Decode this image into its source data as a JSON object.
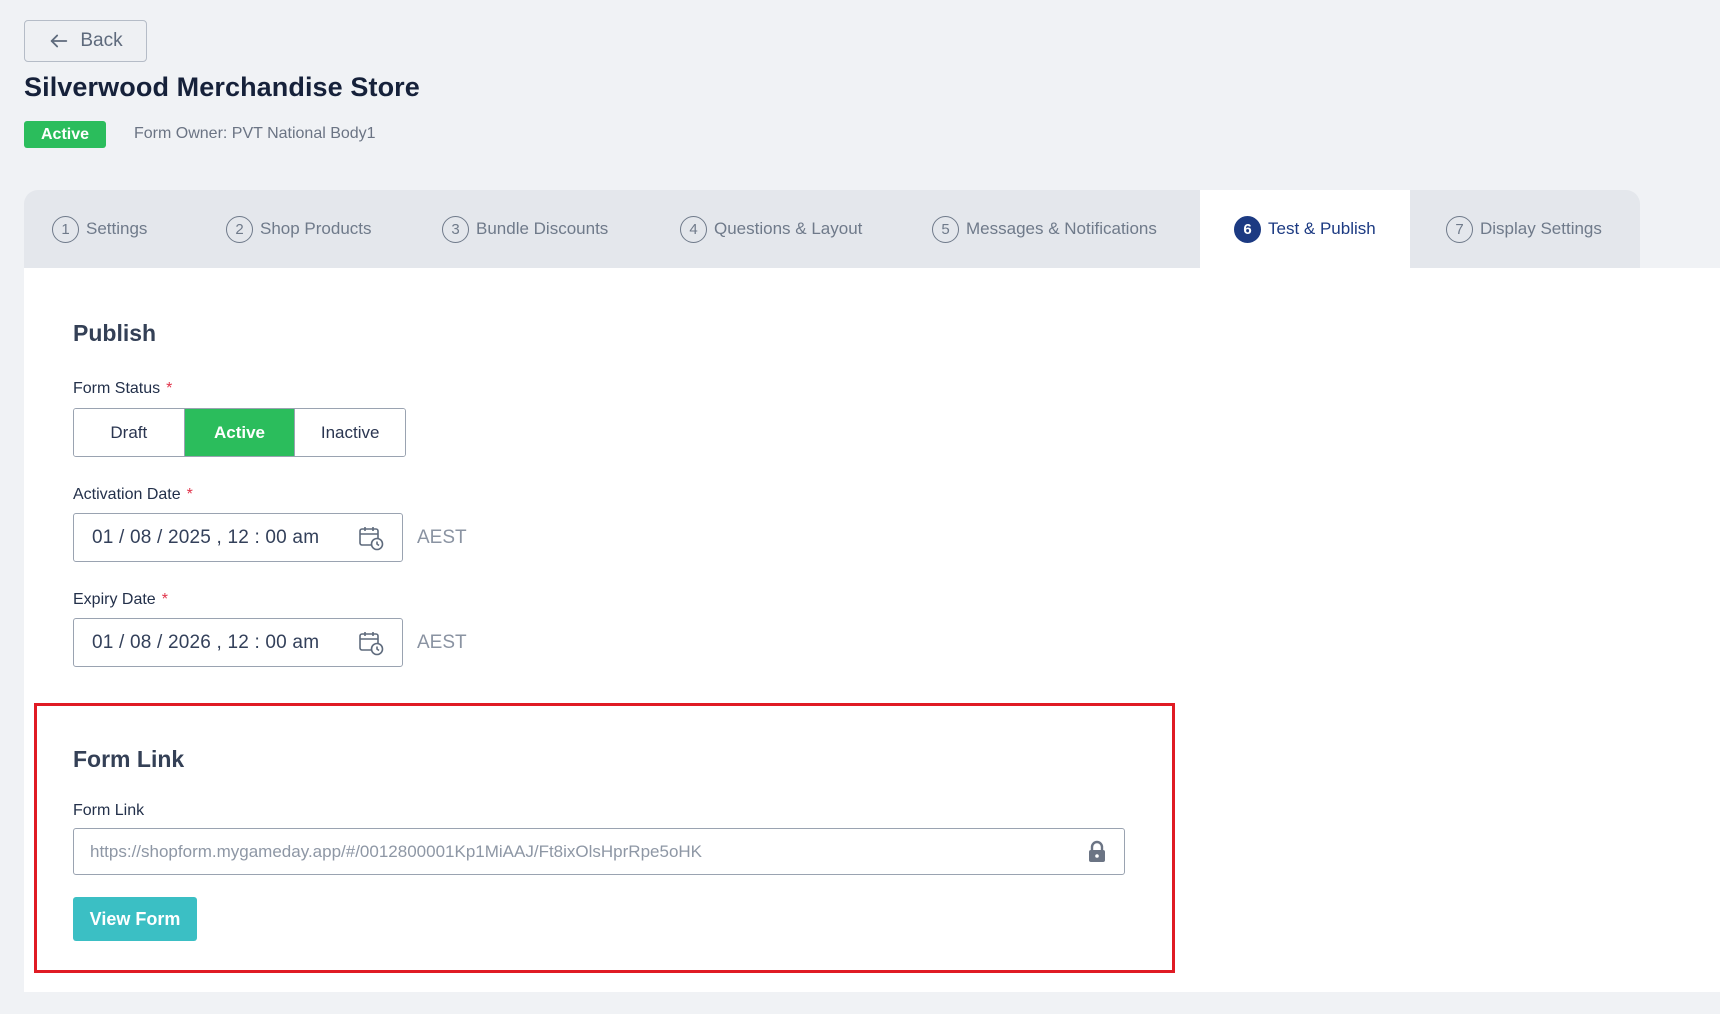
{
  "back": {
    "label": "Back"
  },
  "page": {
    "title": "Silverwood Merchandise Store",
    "status_badge": "Active",
    "owner": "Form Owner: PVT National Body1"
  },
  "tabs": [
    {
      "num": "1",
      "label": "Settings"
    },
    {
      "num": "2",
      "label": "Shop Products"
    },
    {
      "num": "3",
      "label": "Bundle Discounts"
    },
    {
      "num": "4",
      "label": "Questions & Layout"
    },
    {
      "num": "5",
      "label": "Messages & Notifications"
    },
    {
      "num": "6",
      "label": "Test & Publish",
      "active": true
    },
    {
      "num": "7",
      "label": "Display Settings"
    }
  ],
  "publish": {
    "title": "Publish",
    "form_status_label": "Form Status",
    "required_mark": "*",
    "status_options": [
      "Draft",
      "Active",
      "Inactive"
    ],
    "selected_status": "Active",
    "activation_label": "Activation Date",
    "activation_value": "01 / 08 / 2025 ,  12 : 00  am",
    "expiry_label": "Expiry Date",
    "expiry_value": "01 / 08 / 2026 ,  12 : 00  am",
    "timezone": "AEST"
  },
  "form_link": {
    "title": "Form Link",
    "field_label": "Form Link",
    "value": "https://shopform.mygameday.app/#/0012800001Kp1MiAAJ/Ft8ixOlsHprRpe5oHK",
    "view_button": "View Form"
  },
  "colors": {
    "active_green": "#2bbd5c",
    "tab_active": "#1c3a82",
    "view_button": "#3bbfc4",
    "highlight_border": "#e01b24"
  }
}
